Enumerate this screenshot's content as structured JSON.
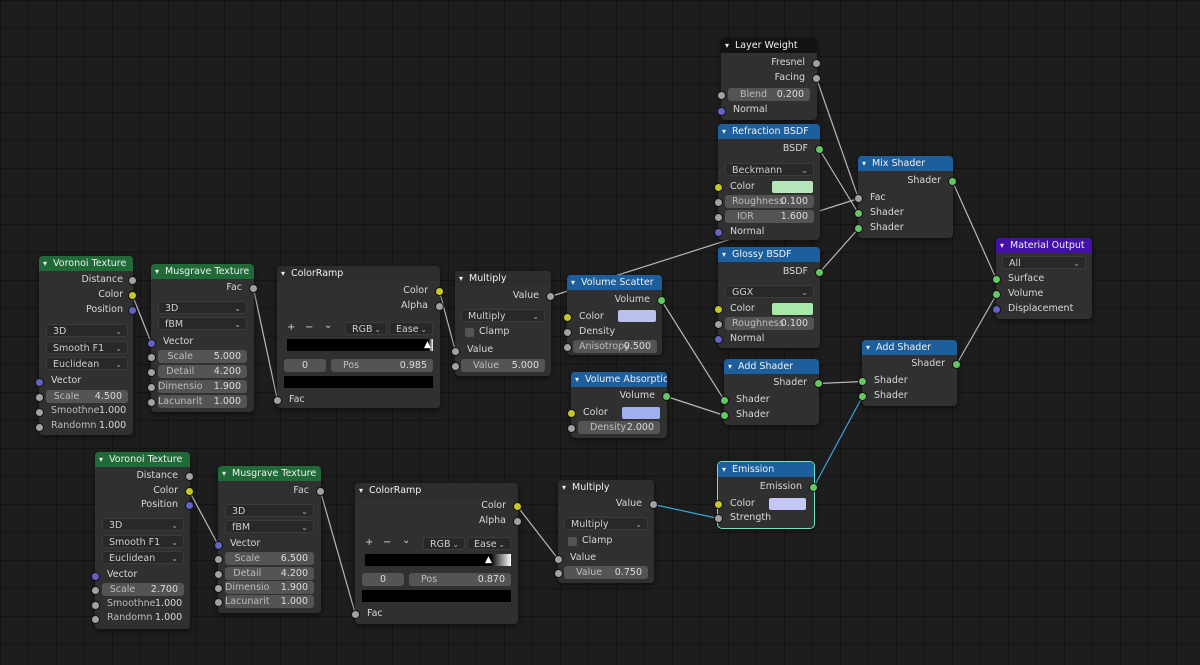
{
  "colors": {
    "background": "#1d1d1d",
    "node_body": "#303030",
    "texture_header": "#1f6a37",
    "shader_header": "#1d5f9c",
    "converter_header": "#2d2d2d",
    "input_header": "#121212",
    "output_header": "#4311a6",
    "socket_shader": "#63c763",
    "socket_color": "#c7c729",
    "socket_float": "#a1a1a1",
    "socket_vector": "#6363c7",
    "link_default": "#b8b8b8",
    "link_selected": "#3aa6d8"
  },
  "icons": {
    "collapse": "triangle-down-icon",
    "dropdown": "chevron-down-icon",
    "ramp_stop": "ramp-stop-icon"
  },
  "voronoi1": {
    "title": "Voronoi Texture",
    "distance": "Distance",
    "color": "Color",
    "position": "Position",
    "dim": "3D",
    "feature": "Smooth F1",
    "metric": "Euclidean",
    "vector": "Vector",
    "scale_k": "Scale",
    "scale_v": "4.500",
    "smooth_k": "Smoothne",
    "smooth_v": "1.000",
    "rand_k": "Randomn",
    "rand_v": "1.000"
  },
  "musgrave1": {
    "title": "Musgrave Texture",
    "fac": "Fac",
    "dim": "3D",
    "type": "fBM",
    "vector": "Vector",
    "scale_k": "Scale",
    "scale_v": "5.000",
    "detail_k": "Detail",
    "detail_v": "4.200",
    "dim_k": "Dimensio",
    "dim_v": "1.900",
    "lac_k": "Lacunarit",
    "lac_v": "1.000"
  },
  "ramp1": {
    "title": "ColorRamp",
    "color": "Color",
    "alpha": "Alpha",
    "plus": "+",
    "minus": "−",
    "more": "⌄",
    "mode": "RGB",
    "interp": "Ease",
    "index": "0",
    "pos_k": "Pos",
    "pos_v": "0.985",
    "fac": "Fac"
  },
  "multiply1": {
    "title": "Multiply",
    "value_out": "Value",
    "op": "Multiply",
    "clamp": "Clamp",
    "value_in": "Value",
    "field_k": "Value",
    "field_v": "5.000"
  },
  "vscatter": {
    "title": "Volume Scatter",
    "volume": "Volume",
    "color": "Color",
    "density": "Density",
    "aniso_k": "Anisotropy",
    "aniso_v": "0.500",
    "swatch": "#b9c1ea"
  },
  "vabsorb": {
    "title": "Volume Absorption",
    "volume": "Volume",
    "color": "Color",
    "density_k": "Density",
    "density_v": "2.000",
    "swatch": "#9fb0ef"
  },
  "layerweight": {
    "title": "Layer Weight",
    "fresnel": "Fresnel",
    "facing": "Facing",
    "blend_k": "Blend",
    "blend_v": "0.200",
    "normal": "Normal"
  },
  "refraction": {
    "title": "Refraction BSDF",
    "bsdf": "BSDF",
    "dist": "Beckmann",
    "color": "Color",
    "rough_k": "Roughness",
    "rough_v": "0.100",
    "ior_k": "IOR",
    "ior_v": "1.600",
    "normal": "Normal",
    "swatch": "#b4e6b9"
  },
  "glossy": {
    "title": "Glossy BSDF",
    "bsdf": "BSDF",
    "dist": "GGX",
    "color": "Color",
    "rough_k": "Roughness",
    "rough_v": "0.100",
    "normal": "Normal",
    "swatch": "#a8e8a9"
  },
  "mixshader": {
    "title": "Mix Shader",
    "shader_out": "Shader",
    "fac": "Fac",
    "shader1": "Shader",
    "shader2": "Shader"
  },
  "addshader1": {
    "title": "Add Shader",
    "shader_out": "Shader",
    "shader1": "Shader",
    "shader2": "Shader"
  },
  "addshader2": {
    "title": "Add Shader",
    "shader_out": "Shader",
    "shader1": "Shader",
    "shader2": "Shader"
  },
  "matout": {
    "title": "Material Output",
    "target": "All",
    "surface": "Surface",
    "volume": "Volume",
    "displacement": "Displacement"
  },
  "emission": {
    "title": "Emission",
    "emission": "Emission",
    "color": "Color",
    "strength": "Strength",
    "swatch": "#c3c6f6"
  },
  "voronoi2": {
    "title": "Voronoi Texture",
    "distance": "Distance",
    "color": "Color",
    "position": "Position",
    "dim": "3D",
    "feature": "Smooth F1",
    "metric": "Euclidean",
    "vector": "Vector",
    "scale_k": "Scale",
    "scale_v": "2.700",
    "smooth_k": "Smoothne",
    "smooth_v": "1.000",
    "rand_k": "Randomn",
    "rand_v": "1.000"
  },
  "musgrave2": {
    "title": "Musgrave Texture",
    "fac": "Fac",
    "dim": "3D",
    "type": "fBM",
    "vector": "Vector",
    "scale_k": "Scale",
    "scale_v": "6.500",
    "detail_k": "Detail",
    "detail_v": "4.200",
    "dim_k": "Dimensio",
    "dim_v": "1.900",
    "lac_k": "Lacunarit",
    "lac_v": "1.000"
  },
  "ramp2": {
    "title": "ColorRamp",
    "color": "Color",
    "alpha": "Alpha",
    "plus": "+",
    "minus": "−",
    "more": "⌄",
    "mode": "RGB",
    "interp": "Ease",
    "index": "0",
    "pos_k": "Pos",
    "pos_v": "0.870",
    "fac": "Fac"
  },
  "multiply2": {
    "title": "Multiply",
    "value_out": "Value",
    "op": "Multiply",
    "clamp": "Clamp",
    "value_in": "Value",
    "field_k": "Value",
    "field_v": "0.750"
  }
}
